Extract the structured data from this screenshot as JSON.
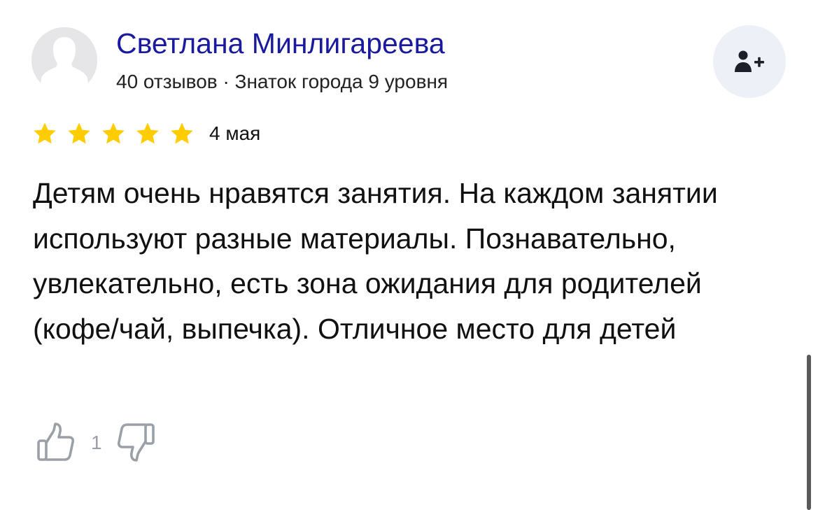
{
  "author": {
    "name": "Светлана Минлигареева",
    "meta": "40 отзывов · Знаток города 9 уровня",
    "avatar_icon": "default-user-avatar-icon"
  },
  "subscribe_button": {
    "icon": "add-person-icon"
  },
  "review": {
    "rating": 5,
    "max_rating": 5,
    "date": "4 мая",
    "text": "Детям очень нравятся занятия. На каждом занятии используют разные материалы. Познавательно, увлекательно, есть зона ожидания для родителей (кофе/чай, выпечка). Отличное место для детей"
  },
  "reactions": {
    "like_count": "1",
    "like_icon": "thumbs-up-icon",
    "dislike_icon": "thumbs-down-icon"
  },
  "colors": {
    "author_name": "#1a1a9e",
    "star": "#ffcc00",
    "subscribe_bg": "#edf0f7",
    "reaction_icon": "#9aa0a8"
  }
}
